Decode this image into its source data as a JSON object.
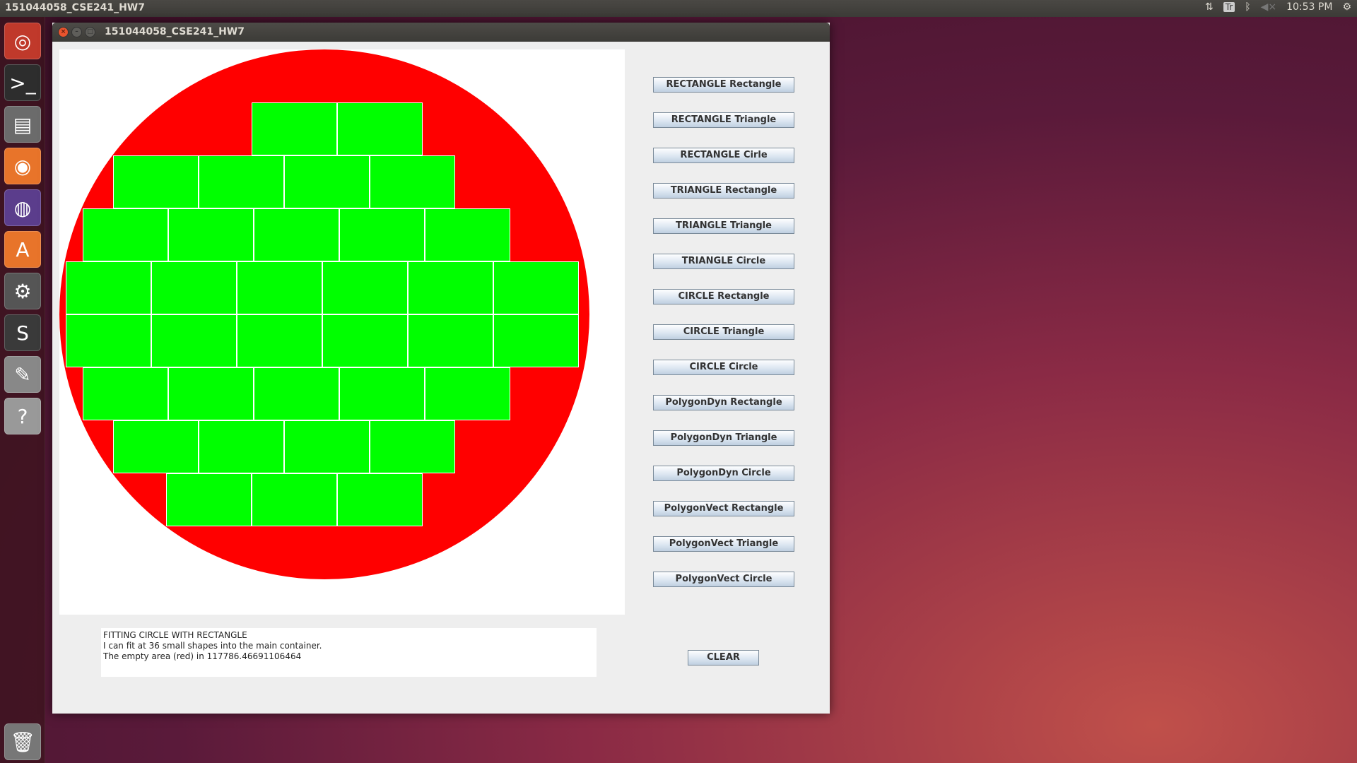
{
  "topbar": {
    "title": "151044058_CSE241_HW7",
    "keyboard": "Tr",
    "time": "10:53 PM"
  },
  "launcher": {
    "items": [
      "ubuntu-home",
      "terminal",
      "files",
      "firefox",
      "eclipse",
      "software-center",
      "system-settings",
      "sublime-text",
      "text-editor",
      "help",
      "trash"
    ]
  },
  "window": {
    "title": "151044058_CSE241_HW7"
  },
  "canvas": {
    "container_color": "#ff0000",
    "shape_color": "#00ff00",
    "rows": [
      2,
      4,
      5,
      6,
      6,
      5,
      4,
      3
    ]
  },
  "buttons": [
    "RECTANGLE Rectangle",
    "RECTANGLE Triangle",
    "RECTANGLE Cirle",
    "TRIANGLE Rectangle",
    "TRIANGLE Triangle",
    "TRIANGLE Circle",
    "CIRCLE Rectangle",
    "CIRCLE Triangle",
    "CIRCLE Circle",
    "PolygonDyn Rectangle",
    "PolygonDyn Triangle",
    "PolygonDyn Circle",
    "PolygonVect Rectangle",
    "PolygonVect Triangle",
    "PolygonVect Circle"
  ],
  "output": {
    "lines": [
      "FITTING CIRCLE WITH RECTANGLE",
      "I can fit at 36 small shapes into the main container.",
      "The empty area (red) in 117786.46691106464"
    ]
  },
  "clear_label": "CLEAR"
}
